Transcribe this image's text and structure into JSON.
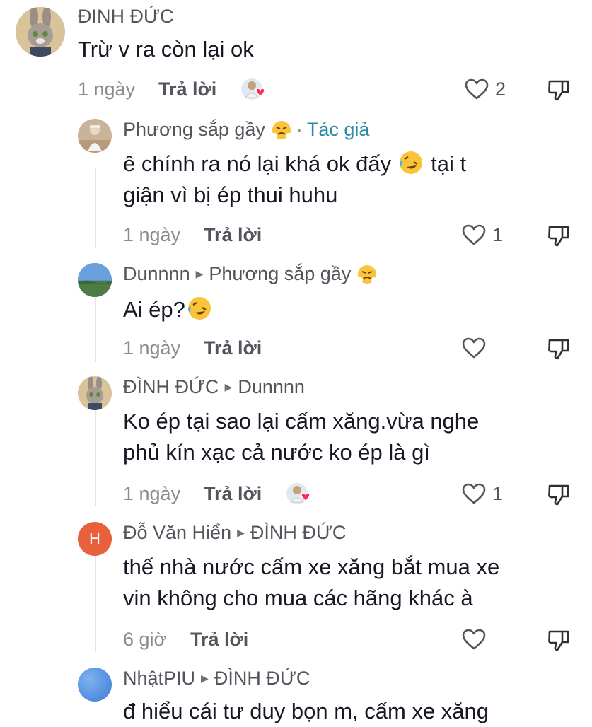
{
  "comments": [
    {
      "name": "ĐINH ĐỨC",
      "text": "Trừ v ra còn lại ok",
      "time": "1 ngày",
      "reply": "Trả lời",
      "likes": "2",
      "creator_liked": true
    },
    {
      "name": "Phương sắp gầy",
      "author_tag": "Tác giả",
      "text_line1": "ê chính ra nó lại khá ok đấy",
      "text_line1b": "tại t",
      "text_line2": "giận vì bị ép thui huhu",
      "time": "1 ngày",
      "reply": "Trả lời",
      "likes": "1"
    },
    {
      "name": "Dunnnn",
      "reply_to": "Phương sắp gầy",
      "text": "Ai ép?",
      "time": "1 ngày",
      "reply": "Trả lời",
      "likes": ""
    },
    {
      "name": "ĐÌNH ĐỨC",
      "reply_to": "Dunnnn",
      "text_line1": "Ko ép tại sao lại cấm xăng.vừa nghe",
      "text_line2": "phủ kín xạc cả nước ko ép là gì",
      "time": "1 ngày",
      "reply": "Trả lời",
      "likes": "1",
      "creator_liked": true
    },
    {
      "name": "Đỗ Văn Hiển",
      "avatar_letter": "H",
      "reply_to": "ĐÌNH ĐỨC",
      "text_line1": "thế nhà nước cấm xe xăng bắt mua xe",
      "text_line2": "vin không cho mua các hãng khác à",
      "time": "6 giờ",
      "reply": "Trả lời",
      "likes": ""
    },
    {
      "name": "NhậtPIU",
      "reply_to": "ĐÌNH ĐỨC",
      "text": "đ hiểu cái tư duy bọn m, cấm xe xăng"
    }
  ],
  "icons": {
    "heart": "heart-outline-icon",
    "dislike": "thumbs-down-icon",
    "angry_emoji": "huffing-face-emoji",
    "laugh_emoji": "rolling-laughing-emoji",
    "reply_arrow": "reply-arrow-icon"
  },
  "colors": {
    "author_tag": "#2a8ca4",
    "creator_heart": "#fe2c55",
    "avatar_h": "#e8603c",
    "avatar_blue": "#4a8ee0"
  }
}
